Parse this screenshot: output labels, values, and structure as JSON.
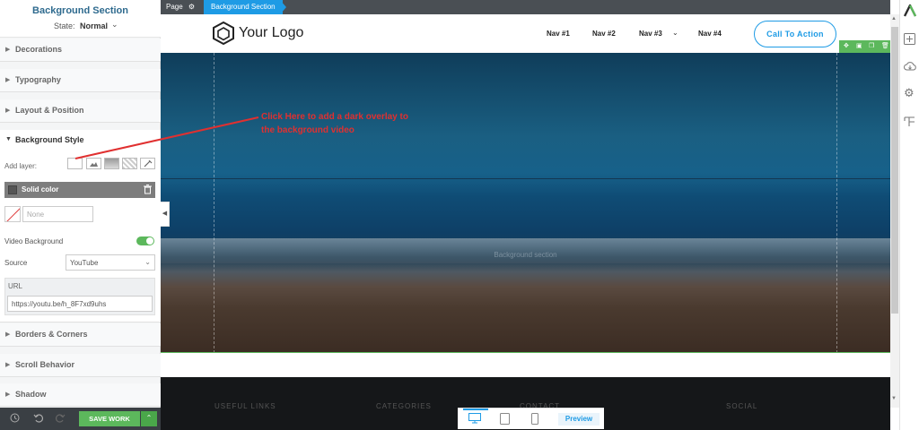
{
  "panel": {
    "title": "Background Section",
    "state_label": "State:",
    "state_value": "Normal",
    "accordions": {
      "decorations": "Decorations",
      "typography": "Typography",
      "layout": "Layout & Position",
      "background_style": "Background Style",
      "borders": "Borders & Corners",
      "scroll": "Scroll Behavior",
      "shadow": "Shadow"
    },
    "add_layer_label": "Add layer:",
    "solid_color_label": "Solid color",
    "color_placeholder": "None",
    "video_bg_label": "Video Background",
    "video_bg_enabled": true,
    "source_label": "Source",
    "source_value": "YouTube",
    "url_label": "URL",
    "url_value": "https://youtu.be/h_8F7xd9uhs",
    "save_label": "SAVE WORK"
  },
  "topbar": {
    "page_label": "Page",
    "crumb": "Background Section"
  },
  "site": {
    "logo": "Your Logo",
    "nav": [
      "Nav #1",
      "Nav #2",
      "Nav #3",
      "Nav #4"
    ],
    "cta": "Call To Action",
    "hero_label": "Background section",
    "footer_headings": [
      "USEFUL LINKS",
      "CATEGORIES",
      "CONTACT",
      "SOCIAL"
    ]
  },
  "annotation": {
    "line1": "Click Here to add a dark overlay to",
    "line2": "the background video",
    "color": "#e03030"
  },
  "device_bar": {
    "preview": "Preview"
  },
  "colors": {
    "accent": "#1e9be5",
    "save": "#5cb85c",
    "title": "#2e6a8e"
  },
  "icons": {
    "right_sidebar": [
      "brand-logo-icon",
      "add-icon",
      "cloud-icon",
      "gear-icon",
      "layers-icon"
    ]
  }
}
